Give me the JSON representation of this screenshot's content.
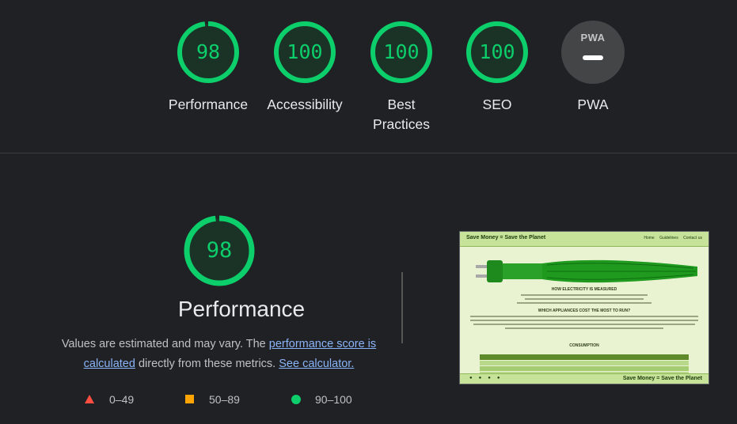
{
  "categories": [
    {
      "score": "98",
      "label": "Performance",
      "fraction": 0.98
    },
    {
      "score": "100",
      "label": "Accessibility",
      "fraction": 1.0
    },
    {
      "score": "100",
      "label": "Best Practices",
      "fraction": 1.0
    },
    {
      "score": "100",
      "label": "SEO",
      "fraction": 1.0
    },
    {
      "score": "",
      "label": "PWA",
      "badge": "PWA"
    }
  ],
  "performance": {
    "score": "98",
    "fraction": 0.98,
    "title": "Performance",
    "desc_prefix": "Values are estimated and may vary. The ",
    "desc_link1": "performance score is calculated",
    "desc_middle": " directly from these metrics. ",
    "desc_link2": "See calculator."
  },
  "legend": [
    {
      "range": "0–49",
      "shape": "triangle",
      "color": "#ff4e42"
    },
    {
      "range": "50–89",
      "shape": "square",
      "color": "#ffa400"
    },
    {
      "range": "90–100",
      "shape": "circle",
      "color": "#0cce6b"
    }
  ],
  "screenshot": {
    "brand": "Save Money = Save the Planet",
    "nav": [
      "Home",
      "Guidelines",
      "Contact us"
    ],
    "heading1": "HOW ELECTRICITY IS MEASURED",
    "heading2": "WHICH APPLIANCES COST THE MOST TO RUN?",
    "heading3": "CONSUMPTION",
    "footer_brand": "Save Money = Save the Planet"
  },
  "colors": {
    "pass": "#0cce6b",
    "pass_bg": "#0c2a1a",
    "bg": "#202124",
    "link": "#8ab4f8"
  }
}
